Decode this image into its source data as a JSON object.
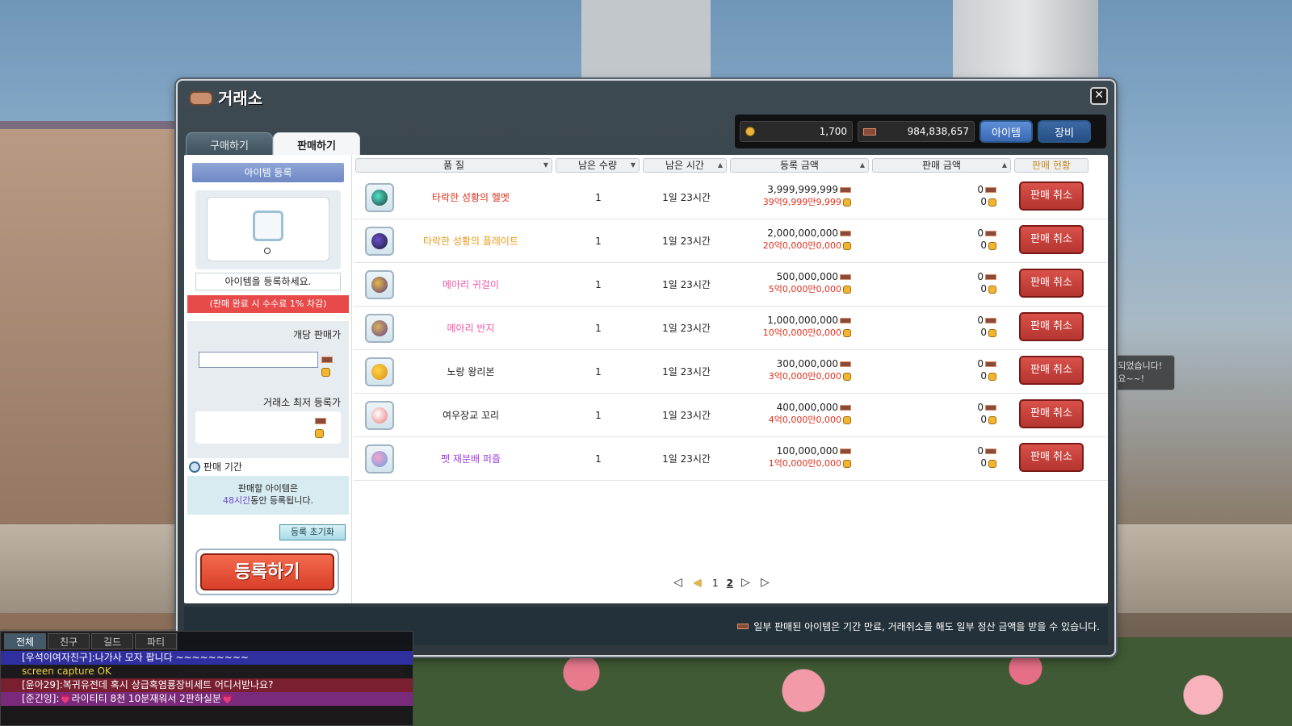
{
  "window": {
    "title": "거래소",
    "close_label": "✕"
  },
  "currency": {
    "meso": "1,700",
    "maple_points": "984,838,657",
    "tab_item": "아이템",
    "tab_equip": "장비"
  },
  "tabs": {
    "buy": "구매하기",
    "sell": "판매하기"
  },
  "left_panel": {
    "header": "아이템 등록",
    "prompt": "아이템을 등록하세요.",
    "fee_notice": "(판매 완료 시 수수료 1% 차감)",
    "unit_price_label": "개당 판매가",
    "unit_price_value": "",
    "min_price_label": "거래소 최저 등록가",
    "period_title": "판매 기간",
    "period_line1": "판매할 아이템은",
    "period_hours": "48시간",
    "period_line2": "동안 등록됩니다.",
    "reset_button": "등록 초기화",
    "register_button": "등록하기"
  },
  "columns": {
    "quality": "품 질",
    "remaining_qty": "남은 수량",
    "remaining_time": "남은 시간",
    "listed_price": "등록 금액",
    "sold_amount": "판매 금액",
    "status": "판매 현황"
  },
  "rows": [
    {
      "name": "타락한 성황의 헬멧",
      "qty": "1",
      "time": "1일 23시간",
      "price": "3,999,999,999",
      "price_korean": "39억9,999만9,999",
      "sold_mp": "0",
      "sold_coin": "0",
      "action": "판매 취소"
    },
    {
      "name": "타락한 성황의 플레이트",
      "qty": "1",
      "time": "1일 23시간",
      "price": "2,000,000,000",
      "price_korean": "20억0,000만0,000",
      "sold_mp": "0",
      "sold_coin": "0",
      "action": "판매 취소"
    },
    {
      "name": "메아리 귀걸이",
      "qty": "1",
      "time": "1일 23시간",
      "price": "500,000,000",
      "price_korean": "5억0,000만0,000",
      "sold_mp": "0",
      "sold_coin": "0",
      "action": "판매 취소"
    },
    {
      "name": "메아리 반지",
      "qty": "1",
      "time": "1일 23시간",
      "price": "1,000,000,000",
      "price_korean": "10억0,000만0,000",
      "sold_mp": "0",
      "sold_coin": "0",
      "action": "판매 취소"
    },
    {
      "name": "노랑 왕리본",
      "qty": "1",
      "time": "1일 23시간",
      "price": "300,000,000",
      "price_korean": "3억0,000만0,000",
      "sold_mp": "0",
      "sold_coin": "0",
      "action": "판매 취소"
    },
    {
      "name": "여우장교 꼬리",
      "qty": "1",
      "time": "1일 23시간",
      "price": "400,000,000",
      "price_korean": "4억0,000만0,000",
      "sold_mp": "0",
      "sold_coin": "0",
      "action": "판매 취소"
    },
    {
      "name": "펫 재분배 퍼즐",
      "qty": "1",
      "time": "1일 23시간",
      "price": "100,000,000",
      "price_korean": "1억0,000만0,000",
      "sold_mp": "0",
      "sold_coin": "0",
      "action": "판매 취소"
    }
  ],
  "pagination": {
    "page1": "1",
    "page2": "2"
  },
  "footer": {
    "notice": "일부 판매된 아이템은 기간 만료, 거래취소를 해도 일부 정산 금액을 받을 수 있습니다."
  },
  "chat": {
    "tabs": [
      "전체",
      "친구",
      "길드",
      "파티"
    ],
    "lines": [
      "[우석이여자친구]:나가사 모자 팝니다 ~~~~~~~~~",
      "screen capture OK",
      "[윤아29]:복귀유전데 혹시 상급혹염룡장비세트 어디서받나요?",
      "[준긴잉]:💗라이티티 8천 10분재워서 2판하실분💗"
    ]
  },
  "scene": {
    "speech": "~되었습니다! ~요~~!"
  }
}
